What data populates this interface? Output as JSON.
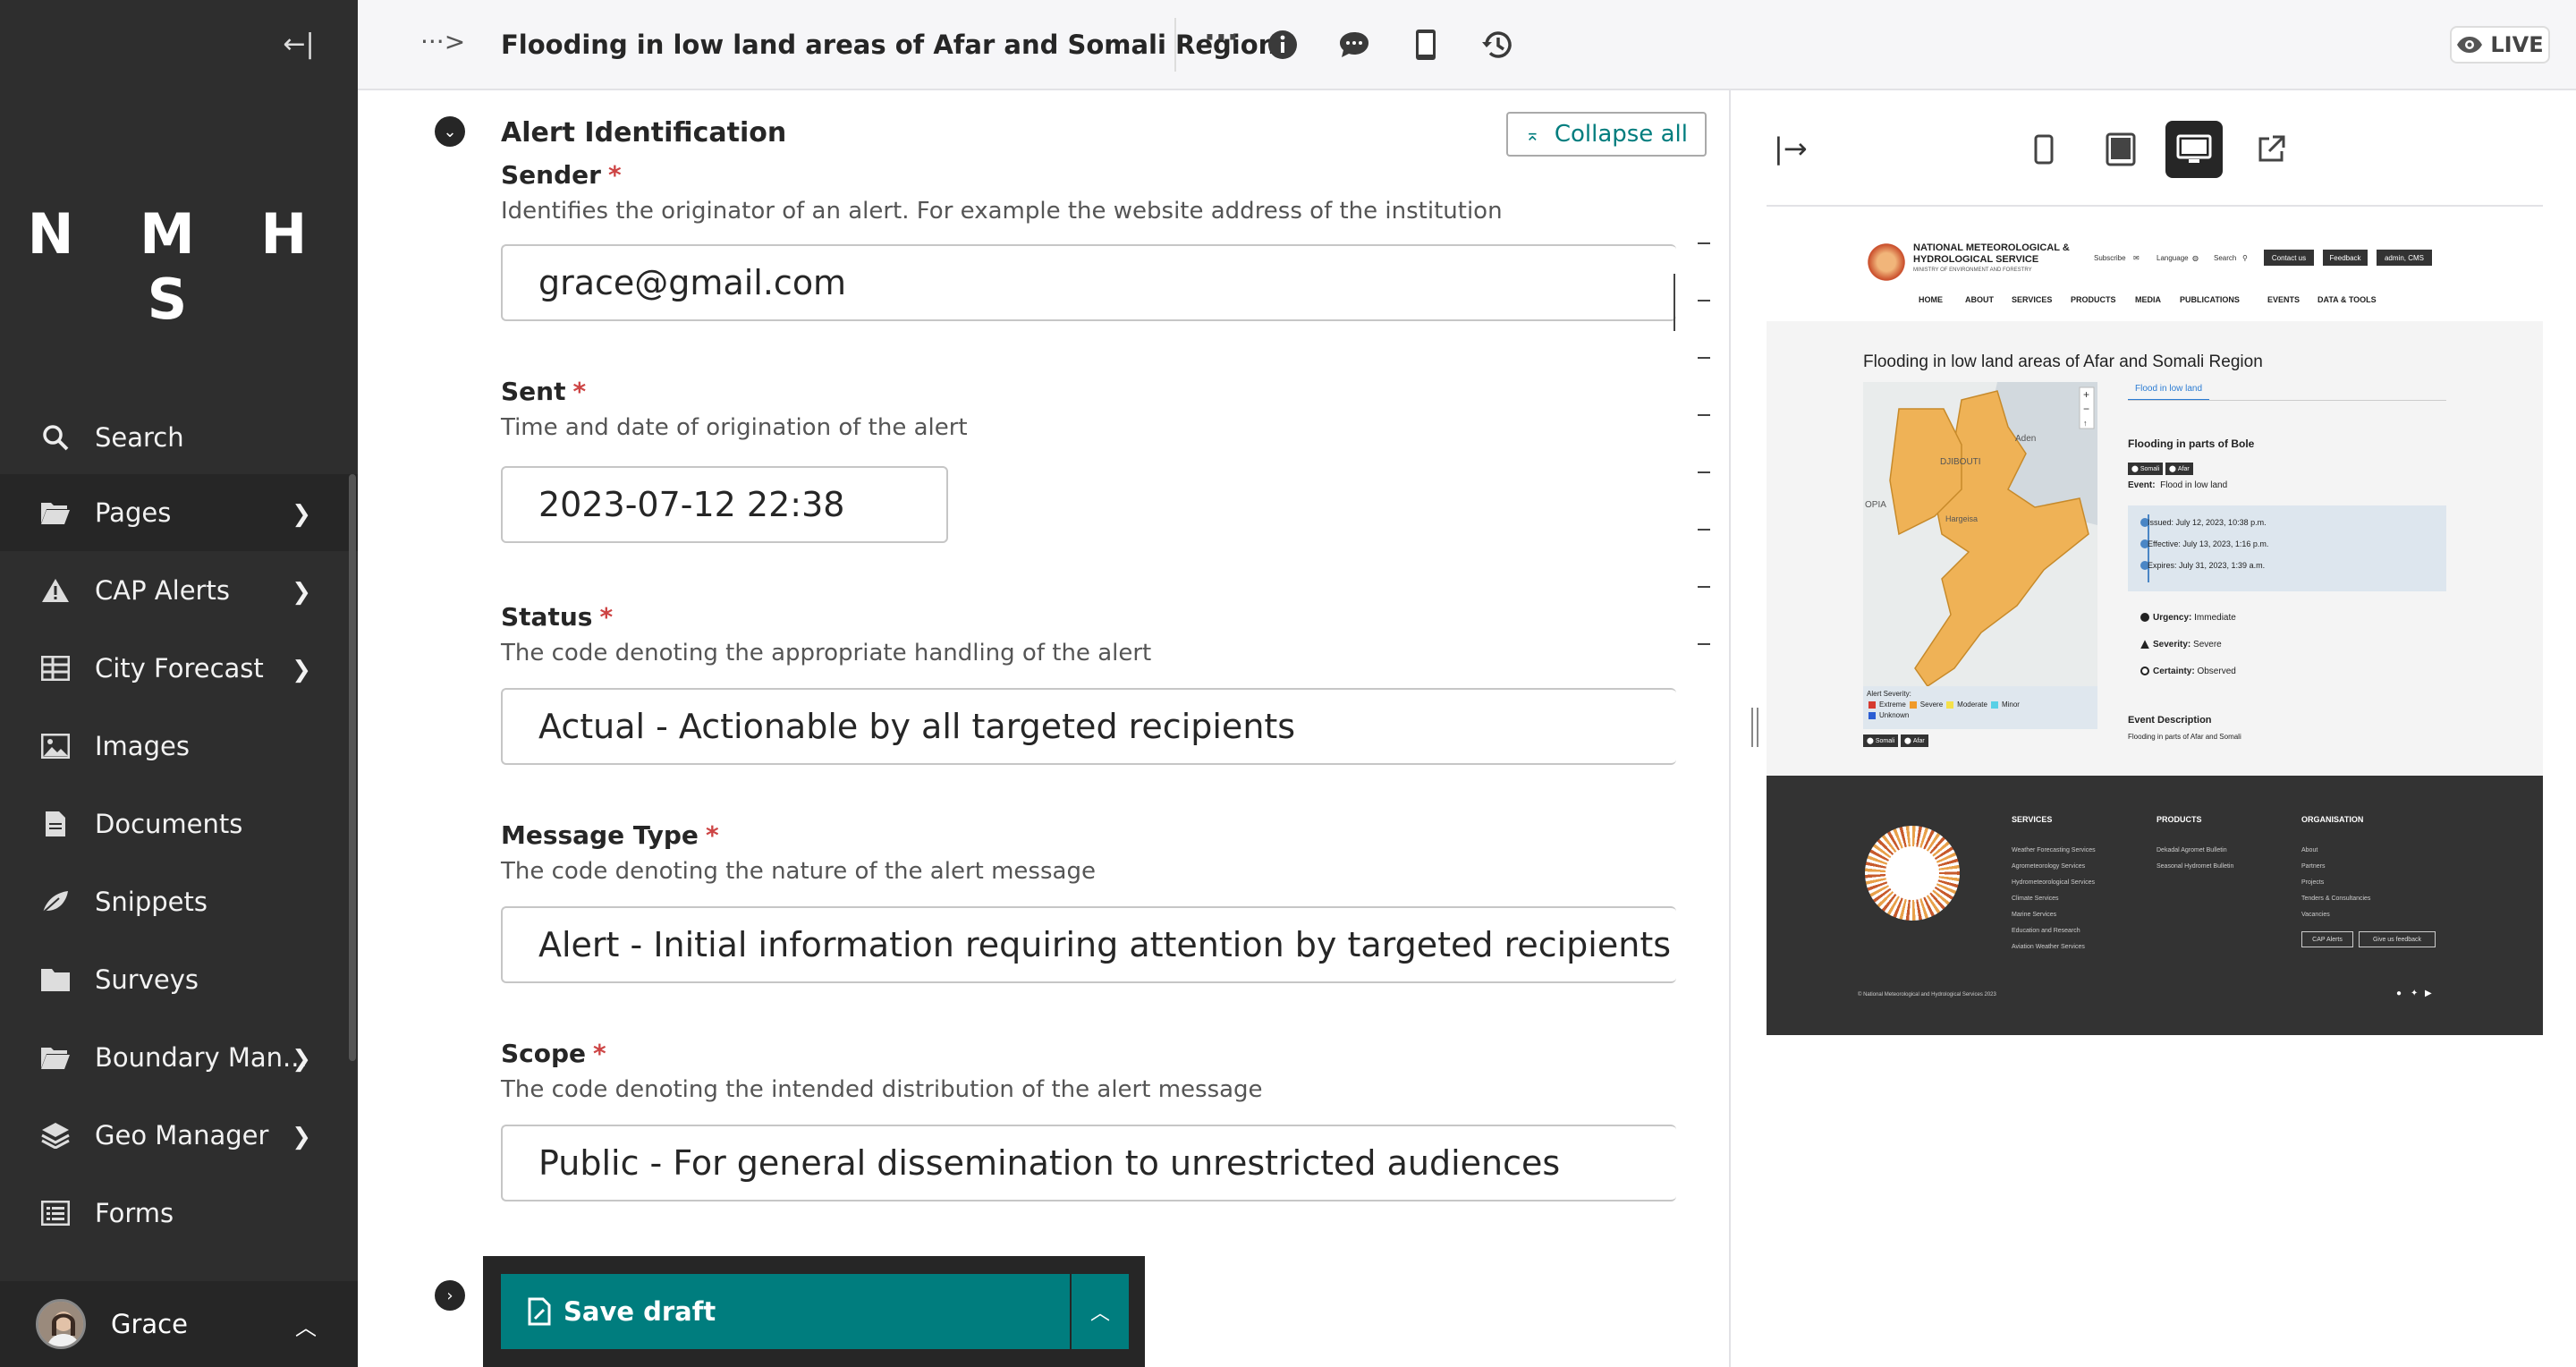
{
  "sidebar": {
    "logo": "N M H S",
    "items": [
      {
        "label": "Search",
        "icon": "search-icon"
      },
      {
        "label": "Pages",
        "icon": "folder-open-icon"
      },
      {
        "label": "CAP Alerts",
        "icon": "warning-icon"
      },
      {
        "label": "City Forecast",
        "icon": "table-icon"
      },
      {
        "label": "Images",
        "icon": "image-icon"
      },
      {
        "label": "Documents",
        "icon": "document-icon"
      },
      {
        "label": "Snippets",
        "icon": "snippet-icon"
      },
      {
        "label": "Surveys",
        "icon": "folder-icon"
      },
      {
        "label": "Boundary Man...",
        "icon": "folder-open-icon"
      },
      {
        "label": "Geo Manager",
        "icon": "layers-icon"
      },
      {
        "label": "Forms",
        "icon": "list-icon"
      }
    ],
    "user": "Grace"
  },
  "topbar": {
    "breadcrumb": "···>",
    "title": "Flooding in low land areas of Afar and Somali Region",
    "live_label": "LIVE"
  },
  "form": {
    "section_title": "Alert Identification",
    "collapse_all": "Collapse all",
    "fields": [
      {
        "label": "Sender",
        "help": "Identifies the originator of an alert. For example the website address of the institution",
        "value": "grace@gmail.com"
      },
      {
        "label": "Sent",
        "help": "Time and date of origination of the alert",
        "value": "2023-07-12 22:38"
      },
      {
        "label": "Status",
        "help": "The code denoting the appropriate handling of the alert",
        "value": "Actual - Actionable by all targeted recipients"
      },
      {
        "label": "Message Type",
        "help": "The code denoting the nature of the alert message",
        "value": "Alert - Initial information requiring attention by targeted recipients"
      },
      {
        "label": "Scope",
        "help": "The code denoting the intended distribution of the alert message",
        "value": "Public - For general dissemination to unrestricted audiences"
      }
    ],
    "required_mark": "*",
    "save_label": "Save draft"
  },
  "preview": {
    "site": {
      "org_name": "NATIONAL METEOROLOGICAL & HYDROLOGICAL SERVICE",
      "org_sub": "MINISTRY OF ENVIRONMENT AND FORESTRY",
      "util": {
        "subscribe": "Subscribe",
        "language": "Language",
        "search": "Search",
        "contact": "Contact us",
        "feedback": "Feedback",
        "admin": "admin, CMS"
      },
      "nav": [
        "HOME",
        "ABOUT",
        "SERVICES",
        "PRODUCTS",
        "MEDIA",
        "PUBLICATIONS",
        "EVENTS",
        "DATA & TOOLS"
      ],
      "page_title": "Flooding in low land areas of Afar and Somali Region",
      "map_labels": {
        "aden": "Aden",
        "djibouti": "DJIBOUTI",
        "opia": "OPIA",
        "hargeisa": "Hargeisa"
      },
      "legend": {
        "title": "Alert Severity:",
        "extreme": "Extreme",
        "severe": "Severe",
        "moderate": "Moderate",
        "minor": "Minor",
        "unknown": "Unknown"
      },
      "map_tags": [
        "Somali",
        "Afar"
      ],
      "tab": "Flood in low land",
      "area_title": "Flooding in parts of Bole",
      "tags": [
        "Somali",
        "Afar"
      ],
      "event_label": "Event:",
      "event_value": "Flood in low land",
      "issued": "Issued: July 12, 2023, 10:38 p.m.",
      "effective": "Effective: July 13, 2023, 1:16 p.m.",
      "expires": "Expires: July 31, 2023, 1:39 a.m.",
      "urgency_label": "Urgency:",
      "urgency": "Immediate",
      "severity_label": "Severity:",
      "severity": "Severe",
      "certainty_label": "Certainty:",
      "certainty": "Observed",
      "desc_title": "Event Description",
      "desc": "Flooding in parts of Afar and Somali",
      "footer": {
        "services_h": "SERVICES",
        "services": [
          "Weather Forecasting Services",
          "Agrometeorology Services",
          "Hydrometeorological Services",
          "Climate Services",
          "Marine Services",
          "Education and Research",
          "Aviation Weather Services"
        ],
        "products_h": "PRODUCTS",
        "products": [
          "Dekadal Agromet Bulletin",
          "Seasonal Hydromet Bulletin"
        ],
        "org_h": "ORGANISATION",
        "org": [
          "About",
          "Partners",
          "Projects",
          "Tenders & Consultancies",
          "Vacancies"
        ],
        "btn_cap": "CAP Alerts",
        "btn_feedback": "Give us feedback",
        "copyright": "© National Meteorological and Hydrological Services 2023"
      }
    }
  }
}
